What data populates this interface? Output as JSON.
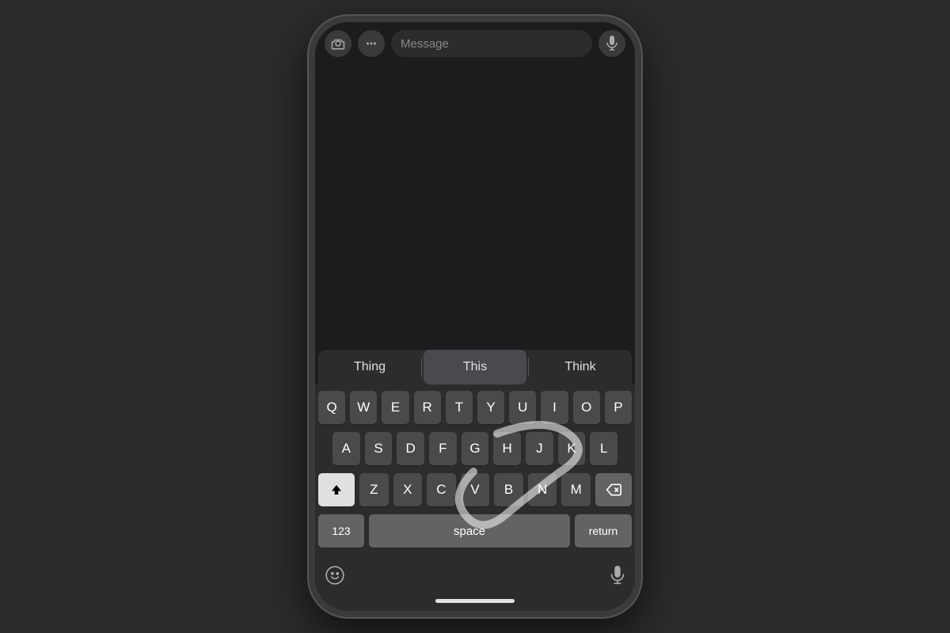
{
  "background_color": "#2c2c2e",
  "phone": {
    "top_bar": {
      "camera_icon": "📷",
      "placeholder": "Message",
      "mic_icon": "🎙"
    },
    "autocomplete": {
      "items": [
        "Thing",
        "This",
        "Think"
      ],
      "active_index": 1
    },
    "keyboard": {
      "rows": [
        [
          "Q",
          "W",
          "E",
          "R",
          "T",
          "Y",
          "U",
          "I",
          "O",
          "P"
        ],
        [
          "A",
          "S",
          "D",
          "F",
          "G",
          "H",
          "J",
          "K",
          "L"
        ],
        [
          "Z",
          "X",
          "C",
          "V",
          "B",
          "N",
          "M"
        ]
      ],
      "special": {
        "shift": "⬆",
        "backspace": "⌫",
        "numbers": "123",
        "space": "space",
        "return": "return"
      }
    },
    "bottom_bar": {
      "emoji_label": "😊",
      "mic_label": "🎙"
    },
    "home_indicator": "—"
  }
}
